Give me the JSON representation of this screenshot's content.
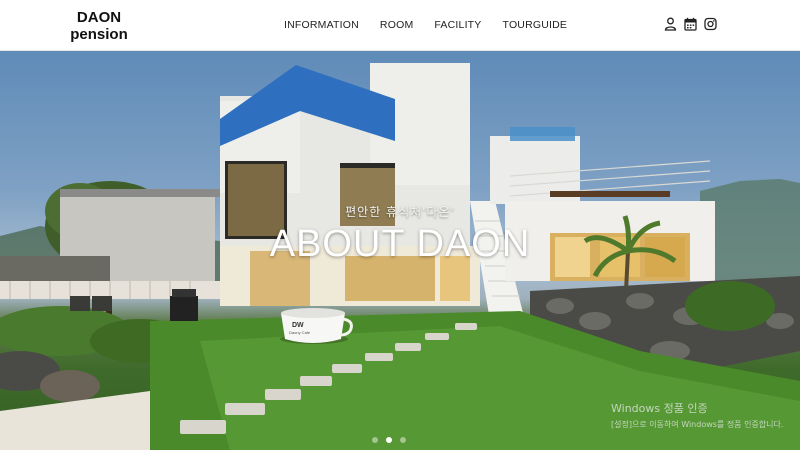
{
  "header": {
    "logo_line1": "DAON",
    "logo_line2": "pension",
    "nav": [
      "INFORMATION",
      "ROOM",
      "FACILITY",
      "TOURGUIDE"
    ],
    "icons": [
      "user-icon",
      "calendar-icon",
      "instagram-icon"
    ]
  },
  "hero": {
    "subtitle": "편안한 휴식처'다온'",
    "title": "ABOUT DAON",
    "slides": 3,
    "active_slide": 2,
    "mug_text_1": "DW",
    "mug_text_2": "Daony Cafe"
  },
  "watermark": {
    "line1": "Windows 정품 인증",
    "line2": "[설정]으로 이동하여 Windows를 정품 인증합니다."
  }
}
